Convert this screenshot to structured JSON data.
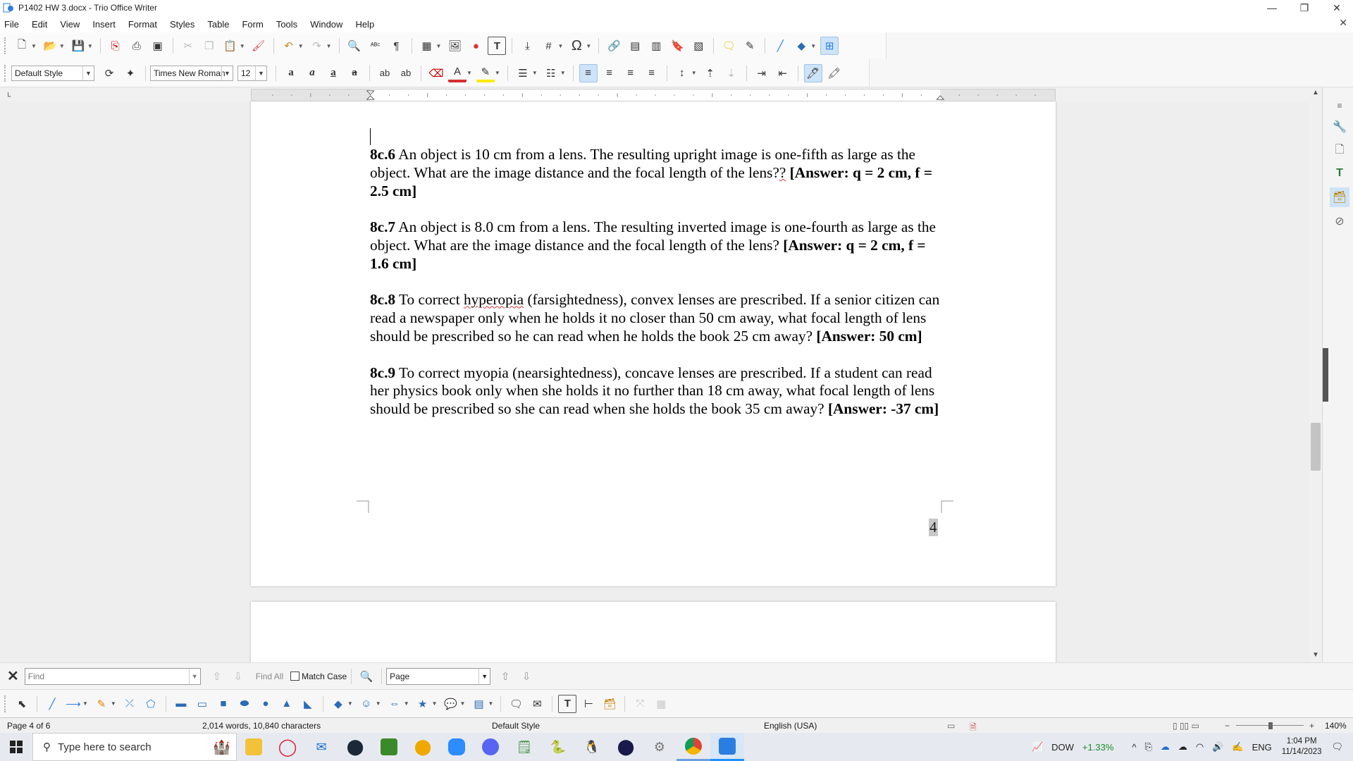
{
  "window": {
    "title": "P1402 HW 3.docx - Trio Office Writer",
    "controls": [
      "—",
      "❐",
      "✕"
    ]
  },
  "menu": [
    "File",
    "Edit",
    "View",
    "Insert",
    "Format",
    "Styles",
    "Table",
    "Form",
    "Tools",
    "Window",
    "Help"
  ],
  "format_toolbar": {
    "paragraph_style": "Default Style",
    "font_name": "Times New Roman",
    "font_size": "12"
  },
  "document": {
    "paragraphs": [
      {
        "id": "8c.6",
        "label": "8c.6",
        "text_a": " An object is 10 cm from a lens. The resulting upright image is one-fifth as large as the object. What are the image distance and the focal length of the lens?",
        "text_b": "?",
        "answer": " [Answer: q = 2 cm, f = 2.5 cm]"
      },
      {
        "id": "8c.7",
        "label": "8c.7",
        "text": " An object is 8.0 cm from a lens. The resulting inverted image is one-fourth as large as the object. What are the image distance and the focal length of the lens?",
        "answer": " [Answer: q = 2 cm, f = 1.6 cm]"
      },
      {
        "id": "8c.8",
        "label": "8c.8",
        "text_a": " To correct ",
        "text_squiggle": "hyperopia",
        "text_b": " (farsightedness), convex lenses are prescribed. If a senior citizen can read a newspaper only when he holds it no closer than 50 cm away, what focal length of lens should be prescribed so he can read when he holds the book 25 cm away?",
        "answer": " [Answer: 50 cm]"
      },
      {
        "id": "8c.9",
        "label": "8c.9",
        "text": " To correct myopia (nearsightedness), concave lenses are prescribed. If a student can read her physics book only when she holds it no further than 18 cm away, what focal length of lens should be prescribed so she can read when she holds the book 35 cm away?",
        "answer": " [Answer: -37 cm]"
      }
    ],
    "page_number": "4"
  },
  "findbar": {
    "placeholder": "Find",
    "find_all": "Find All",
    "match_case": "Match Case",
    "search_by": "Page"
  },
  "statusbar": {
    "page": "Page 4 of 6",
    "words": "2,014 words, 10,840 characters",
    "style": "Default Style",
    "language": "English (USA)",
    "zoom": "140%"
  },
  "taskbar": {
    "search_placeholder": "Type here to search",
    "stock_name": "DOW",
    "stock_change": "+1.33%",
    "language": "ENG",
    "time": "1:04 PM",
    "date": "11/14/2023"
  },
  "colors": {
    "accent": "#1e90ff",
    "font_color_bar": "#d32f2f",
    "highlight_bar": "#ffeb00"
  }
}
